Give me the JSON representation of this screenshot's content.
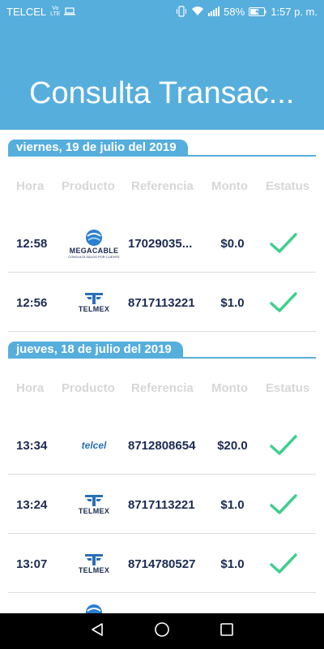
{
  "status_bar": {
    "carrier": "TELCEL",
    "volte_top": "Vo",
    "volte_bottom": "LTE",
    "battery": "58%",
    "time": "1:57 p. m."
  },
  "app_bar": {
    "title": "Consulta Transac..."
  },
  "columns": {
    "hora": "Hora",
    "producto": "Producto",
    "referencia": "Referencia",
    "monto": "Monto",
    "estatus": "Estatus"
  },
  "sections": [
    {
      "date": "viernes, 19 de julio del 2019",
      "rows": [
        {
          "hora": "12:58",
          "producto": "MEGACABLE",
          "producto_sub": "CONSULTA SALDO POR CLIENTE",
          "referencia": "17029035...",
          "monto": "$0.0",
          "estatus": "check-icon"
        },
        {
          "hora": "12:56",
          "producto": "TELMEX",
          "referencia": "8717113221",
          "monto": "$1.0",
          "estatus": "check-icon"
        }
      ]
    },
    {
      "date": "jueves, 18 de julio del 2019",
      "rows": [
        {
          "hora": "13:34",
          "producto": "telcel",
          "referencia": "8712808654",
          "monto": "$20.0",
          "estatus": "check-icon"
        },
        {
          "hora": "13:24",
          "producto": "TELMEX",
          "referencia": "8717113221",
          "monto": "$1.0",
          "estatus": "check-icon"
        },
        {
          "hora": "13:07",
          "producto": "TELMEX",
          "referencia": "8714780527",
          "monto": "$1.0",
          "estatus": "check-icon"
        }
      ]
    }
  ],
  "colors": {
    "primary": "#56aedd",
    "text_dark": "#1b2a52",
    "check": "#3fcf8e",
    "header_gray": "#d7d7d7"
  }
}
